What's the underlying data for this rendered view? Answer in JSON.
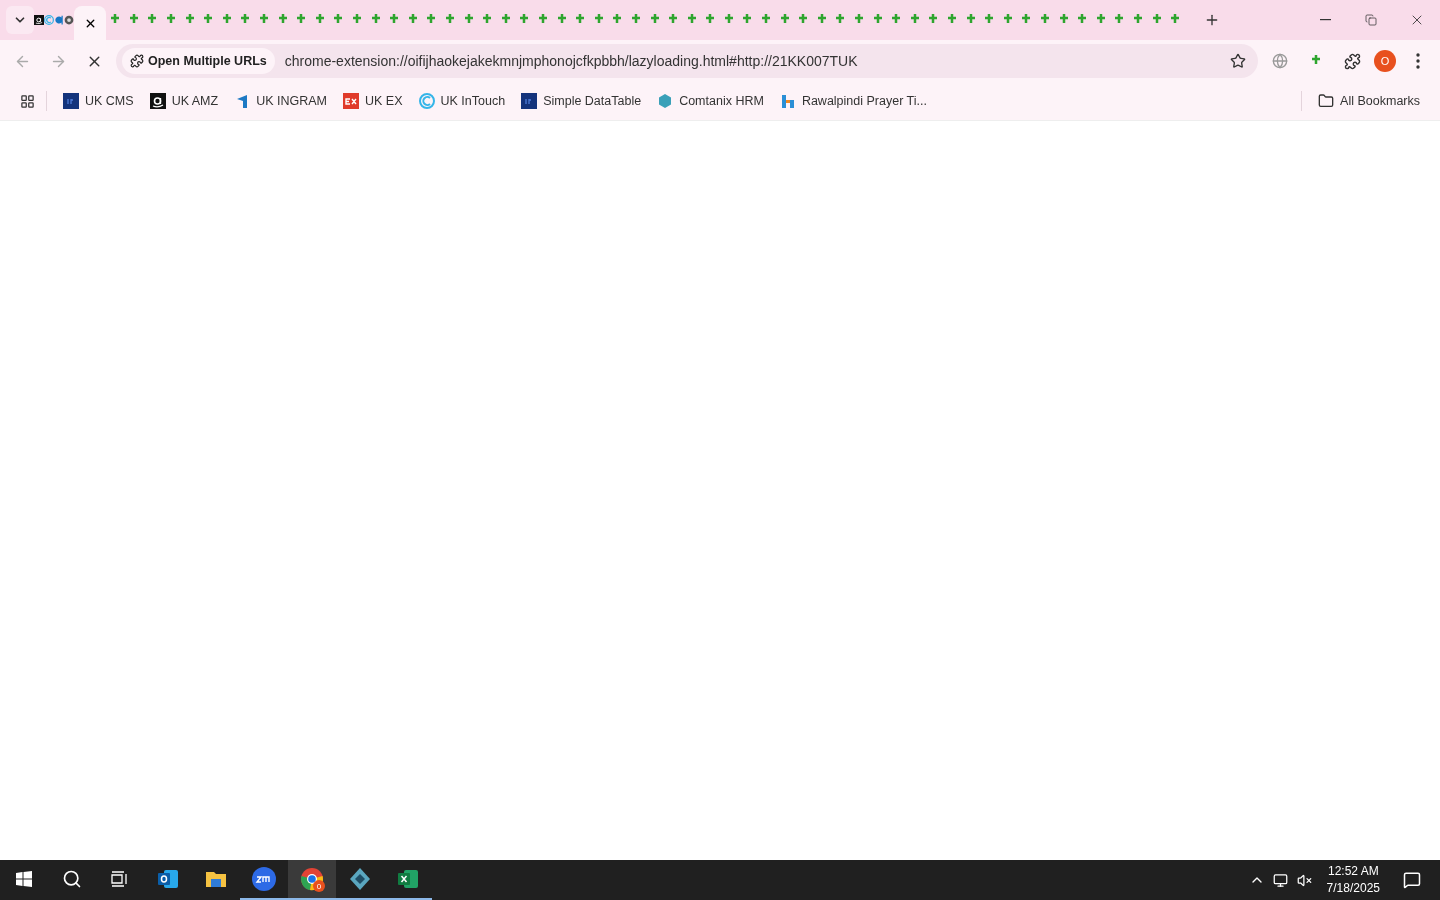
{
  "tabs": [
    {
      "kind": "amazon",
      "selected": false
    },
    {
      "kind": "c-logo",
      "selected": false
    },
    {
      "kind": "d-logo",
      "selected": false
    },
    {
      "kind": "chrome",
      "selected": false
    },
    {
      "selected": true
    },
    {
      "kind": "plus",
      "selected": false
    },
    {
      "kind": "plus",
      "selected": false
    },
    {
      "kind": "plus",
      "selected": false
    },
    {
      "kind": "plus",
      "selected": false
    },
    {
      "kind": "plus",
      "selected": false
    },
    {
      "kind": "plus",
      "selected": false
    },
    {
      "kind": "plus",
      "selected": false
    },
    {
      "kind": "plus",
      "selected": false
    },
    {
      "kind": "plus",
      "selected": false
    },
    {
      "kind": "plus",
      "selected": false
    },
    {
      "kind": "plus",
      "selected": false
    },
    {
      "kind": "plus",
      "selected": false
    },
    {
      "kind": "plus",
      "selected": false
    },
    {
      "kind": "plus",
      "selected": false
    },
    {
      "kind": "plus",
      "selected": false
    },
    {
      "kind": "plus",
      "selected": false
    },
    {
      "kind": "plus",
      "selected": false
    },
    {
      "kind": "plus",
      "selected": false
    },
    {
      "kind": "plus",
      "selected": false
    },
    {
      "kind": "plus",
      "selected": false
    },
    {
      "kind": "plus",
      "selected": false
    },
    {
      "kind": "plus",
      "selected": false
    },
    {
      "kind": "plus",
      "selected": false
    },
    {
      "kind": "plus",
      "selected": false
    },
    {
      "kind": "plus",
      "selected": false
    },
    {
      "kind": "plus",
      "selected": false
    },
    {
      "kind": "plus",
      "selected": false
    },
    {
      "kind": "plus",
      "selected": false
    },
    {
      "kind": "plus",
      "selected": false
    },
    {
      "kind": "plus",
      "selected": false
    },
    {
      "kind": "plus",
      "selected": false
    },
    {
      "kind": "plus",
      "selected": false
    },
    {
      "kind": "plus",
      "selected": false
    },
    {
      "kind": "plus",
      "selected": false
    },
    {
      "kind": "plus",
      "selected": false
    },
    {
      "kind": "plus",
      "selected": false
    },
    {
      "kind": "plus",
      "selected": false
    },
    {
      "kind": "plus",
      "selected": false
    },
    {
      "kind": "plus",
      "selected": false
    },
    {
      "kind": "plus",
      "selected": false
    },
    {
      "kind": "plus",
      "selected": false
    },
    {
      "kind": "plus",
      "selected": false
    },
    {
      "kind": "plus",
      "selected": false
    },
    {
      "kind": "plus",
      "selected": false
    },
    {
      "kind": "plus",
      "selected": false
    },
    {
      "kind": "plus",
      "selected": false
    },
    {
      "kind": "plus",
      "selected": false
    },
    {
      "kind": "plus",
      "selected": false
    },
    {
      "kind": "plus",
      "selected": false
    },
    {
      "kind": "plus",
      "selected": false
    },
    {
      "kind": "plus",
      "selected": false
    },
    {
      "kind": "plus",
      "selected": false
    },
    {
      "kind": "plus",
      "selected": false
    },
    {
      "kind": "plus",
      "selected": false
    },
    {
      "kind": "plus",
      "selected": false
    },
    {
      "kind": "plus",
      "selected": false
    },
    {
      "kind": "plus",
      "selected": false
    },
    {
      "kind": "plus",
      "selected": false
    }
  ],
  "omnibox": {
    "chip": "Open Multiple URLs",
    "url": "chrome-extension://oifijhaokejakekmnjmphonojcfkpbbh/lazyloading.html#http://21KK007TUK"
  },
  "profile": {
    "letter": "O"
  },
  "bookmarks": [
    {
      "label": "UK CMS",
      "kind": "df"
    },
    {
      "label": "UK AMZ",
      "kind": "amazon"
    },
    {
      "label": "UK INGRAM",
      "kind": "ingram"
    },
    {
      "label": "UK EX",
      "kind": "ex"
    },
    {
      "label": "UK InTouch",
      "kind": "c-logo"
    },
    {
      "label": "Simple DataTable",
      "kind": "df"
    },
    {
      "label": "Comtanix HRM",
      "kind": "hex"
    },
    {
      "label": "Rawalpindi Prayer Ti...",
      "kind": "h-logo"
    }
  ],
  "all_bookmarks": "All Bookmarks",
  "taskbar": {
    "apps": [
      {
        "kind": "outlook",
        "selected": false,
        "running": false
      },
      {
        "kind": "folder",
        "selected": false,
        "running": false
      },
      {
        "kind": "zoom",
        "selected": false,
        "running": true
      },
      {
        "kind": "chrome",
        "selected": true,
        "running": true,
        "badge": "0"
      },
      {
        "kind": "diamond",
        "selected": false,
        "running": true
      },
      {
        "kind": "excel",
        "selected": false,
        "running": true
      }
    ],
    "time": "12:52 AM",
    "date": "7/18/2025"
  }
}
